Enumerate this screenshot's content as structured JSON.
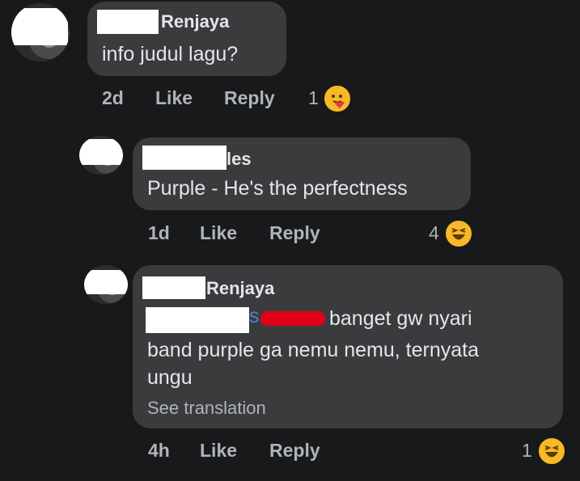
{
  "comments": [
    {
      "name": "Renjaya",
      "text": "info judul lagu?",
      "time": "2d",
      "like_label": "Like",
      "reply_label": "Reply",
      "reaction_count": "1",
      "reaction_icon": "care-hug-emoji"
    },
    {
      "name": "les",
      "text": "Purple - He's the perfectness",
      "time": "1d",
      "like_label": "Like",
      "reply_label": "Reply",
      "reaction_count": "4",
      "reaction_icon": "haha-emoji"
    },
    {
      "name": "Renjaya",
      "text_line1_visible": "banget gw nyari",
      "text_line1_mention_fragment": "s",
      "text_line2": "band purple ga nemu nemu, ternyata",
      "text_line3": "ungu",
      "see_translation": "See translation",
      "time": "4h",
      "like_label": "Like",
      "reply_label": "Reply",
      "reaction_count": "1",
      "reaction_icon": "haha-emoji"
    }
  ],
  "colors": {
    "background": "#18191a",
    "bubble": "#3a3b3c",
    "primary_text": "#e4e6eb",
    "secondary_text": "#b0b3b8",
    "mention": "#4f81d1",
    "emoji": "#f7b928",
    "redaction_mark": "#e0001a"
  }
}
